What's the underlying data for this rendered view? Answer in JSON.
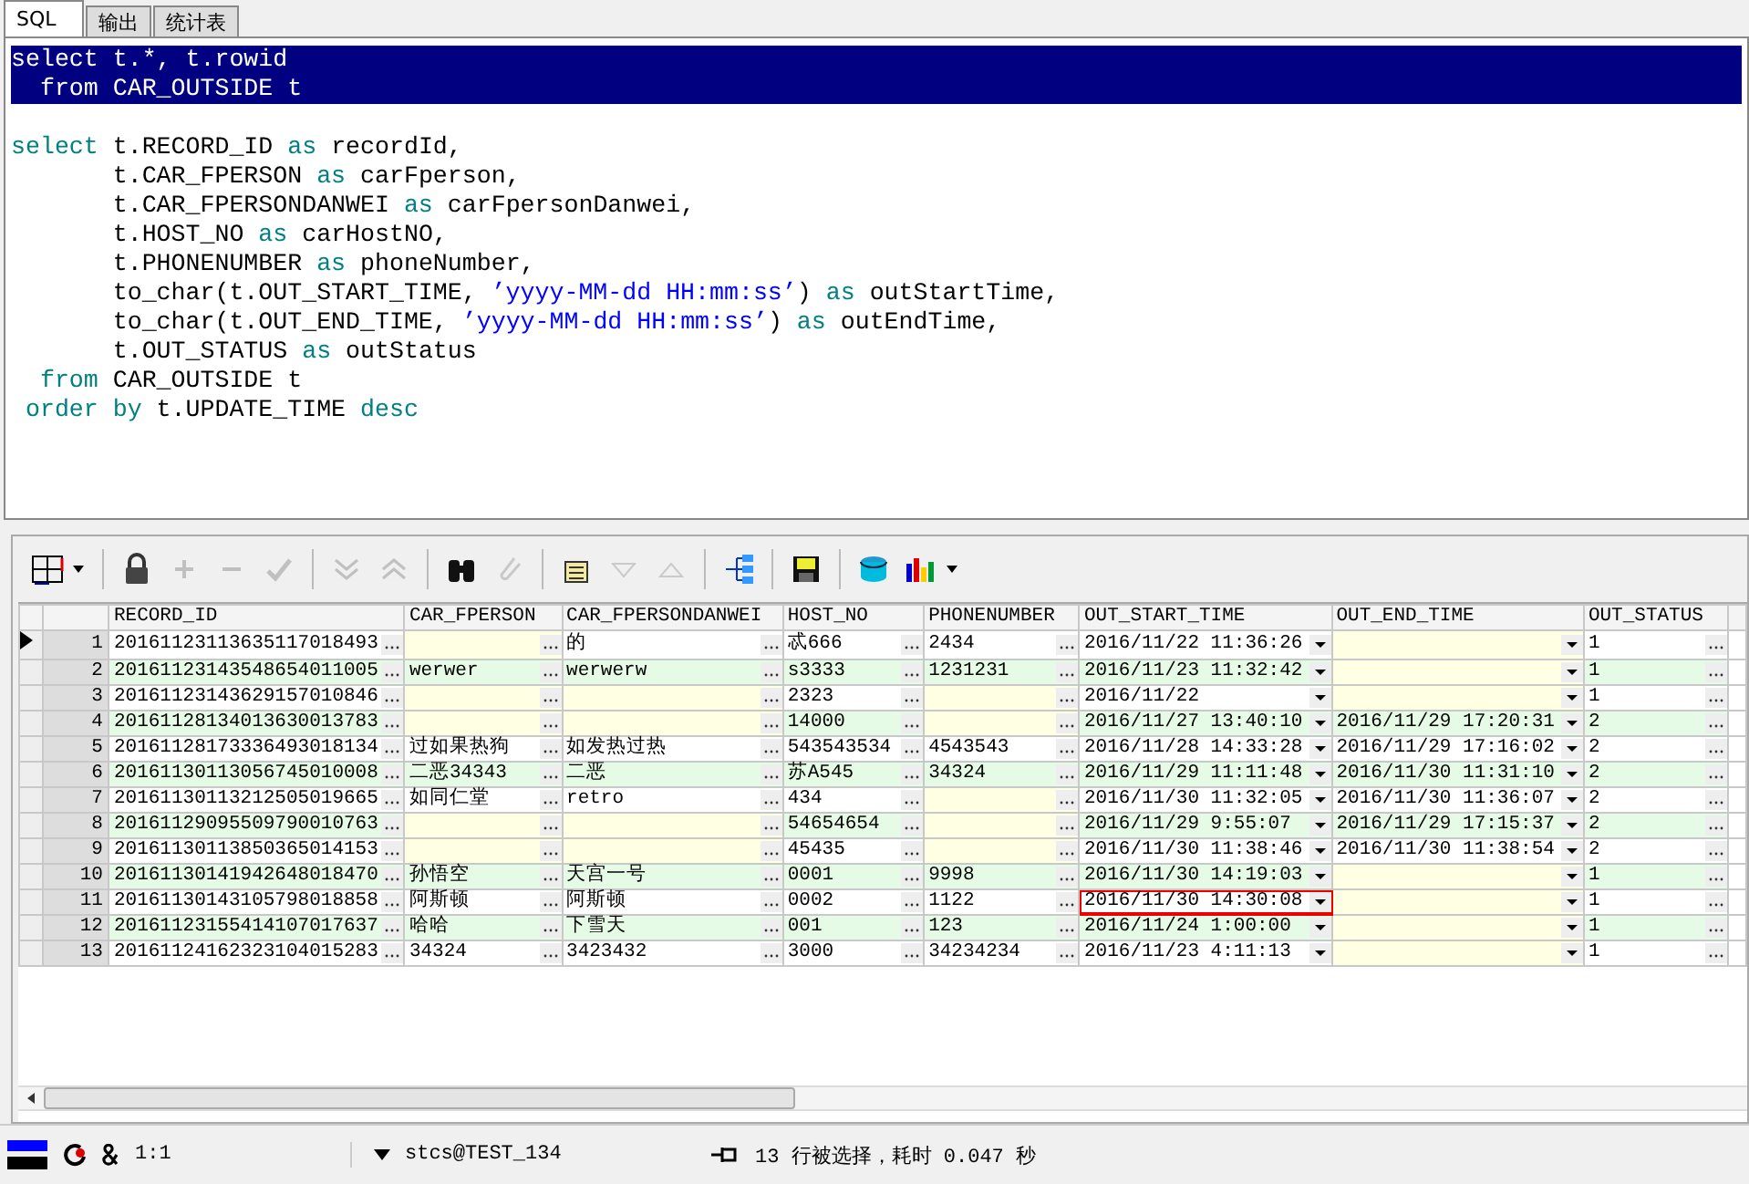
{
  "tabs": [
    {
      "label": "SQL",
      "selected": true
    },
    {
      "label": "输出",
      "selected": false
    },
    {
      "label": "统计表",
      "selected": false
    }
  ],
  "editor": {
    "lines": [
      {
        "kind": "code",
        "selected": true,
        "tokens": [
          {
            "kind": "plain",
            "text": "select t.*, t.rowid"
          }
        ]
      },
      {
        "kind": "code",
        "selected": true,
        "tokens": [
          {
            "kind": "plain",
            "text": "  from CAR_OUTSIDE t"
          }
        ]
      },
      {
        "kind": "blank"
      },
      {
        "kind": "code",
        "selected": false,
        "tokens": [
          {
            "kind": "keyword",
            "text": "select"
          },
          {
            "kind": "plain",
            "text": " t.RECORD_ID "
          },
          {
            "kind": "keyword",
            "text": "as"
          },
          {
            "kind": "plain",
            "text": " recordId,"
          }
        ]
      },
      {
        "kind": "code",
        "selected": false,
        "tokens": [
          {
            "kind": "plain",
            "text": "       t.CAR_FPERSON "
          },
          {
            "kind": "keyword",
            "text": "as"
          },
          {
            "kind": "plain",
            "text": " carFperson,"
          }
        ]
      },
      {
        "kind": "code",
        "selected": false,
        "tokens": [
          {
            "kind": "plain",
            "text": "       t.CAR_FPERSONDANWEI "
          },
          {
            "kind": "keyword",
            "text": "as"
          },
          {
            "kind": "plain",
            "text": " carFpersonDanwei,"
          }
        ]
      },
      {
        "kind": "code",
        "selected": false,
        "tokens": [
          {
            "kind": "plain",
            "text": "       t.HOST_NO "
          },
          {
            "kind": "keyword",
            "text": "as"
          },
          {
            "kind": "plain",
            "text": " carHostNO,"
          }
        ]
      },
      {
        "kind": "code",
        "selected": false,
        "tokens": [
          {
            "kind": "plain",
            "text": "       t.PHONENUMBER "
          },
          {
            "kind": "keyword",
            "text": "as"
          },
          {
            "kind": "plain",
            "text": " phoneNumber,"
          }
        ]
      },
      {
        "kind": "code",
        "selected": false,
        "tokens": [
          {
            "kind": "plain",
            "text": "       to_char(t.OUT_START_TIME, "
          },
          {
            "kind": "string",
            "text": "’yyyy-MM-dd HH:mm:ss’"
          },
          {
            "kind": "plain",
            "text": ") "
          },
          {
            "kind": "keyword",
            "text": "as"
          },
          {
            "kind": "plain",
            "text": " outStartTime,"
          }
        ]
      },
      {
        "kind": "code",
        "selected": false,
        "tokens": [
          {
            "kind": "plain",
            "text": "       to_char(t.OUT_END_TIME, "
          },
          {
            "kind": "string",
            "text": "’yyyy-MM-dd HH:mm:ss’"
          },
          {
            "kind": "plain",
            "text": ") "
          },
          {
            "kind": "keyword",
            "text": "as"
          },
          {
            "kind": "plain",
            "text": " outEndTime,"
          }
        ]
      },
      {
        "kind": "code",
        "selected": false,
        "tokens": [
          {
            "kind": "plain",
            "text": "       t.OUT_STATUS "
          },
          {
            "kind": "keyword",
            "text": "as"
          },
          {
            "kind": "plain",
            "text": " outStatus"
          }
        ]
      },
      {
        "kind": "code",
        "selected": false,
        "tokens": [
          {
            "kind": "keyword",
            "text": "  from"
          },
          {
            "kind": "plain",
            "text": " CAR_OUTSIDE t"
          }
        ]
      },
      {
        "kind": "code",
        "selected": false,
        "tokens": [
          {
            "kind": "keyword",
            "text": " order by"
          },
          {
            "kind": "plain",
            "text": " t.UPDATE_TIME "
          },
          {
            "kind": "keyword",
            "text": "desc"
          }
        ]
      }
    ]
  },
  "toolbar": [
    {
      "kind": "grid",
      "disabled": false
    },
    {
      "kind": "lock",
      "disabled": false
    },
    {
      "kind": "plus",
      "disabled": true
    },
    {
      "kind": "minus",
      "disabled": true
    },
    {
      "kind": "check",
      "disabled": true
    },
    {
      "kind": "chevrons-down",
      "disabled": true
    },
    {
      "kind": "chevrons-up",
      "disabled": true
    },
    {
      "kind": "binoculars",
      "disabled": false
    },
    {
      "kind": "clip",
      "disabled": true
    },
    {
      "kind": "export",
      "disabled": false
    },
    {
      "kind": "triangle-down",
      "disabled": true
    },
    {
      "kind": "triangle-up",
      "disabled": true
    },
    {
      "kind": "tree",
      "disabled": false
    },
    {
      "kind": "save",
      "disabled": false
    },
    {
      "kind": "database",
      "disabled": false
    },
    {
      "kind": "chart",
      "disabled": false
    }
  ],
  "table": {
    "columns": [
      {
        "label": "RECORD_ID",
        "kind": "text"
      },
      {
        "label": "CAR_FPERSON",
        "kind": "text"
      },
      {
        "label": "CAR_FPERSONDANWEI",
        "kind": "text"
      },
      {
        "label": "HOST_NO",
        "kind": "text"
      },
      {
        "label": "PHONENUMBER",
        "kind": "text"
      },
      {
        "label": "OUT_START_TIME",
        "kind": "date"
      },
      {
        "label": "OUT_END_TIME",
        "kind": "date"
      },
      {
        "label": "OUT_STATUS",
        "kind": "text"
      }
    ],
    "rows": [
      {
        "number": "1",
        "selected": true,
        "cells": [
          {
            "text": "20161123113635117018493",
            "focused": false
          },
          {
            "focused": false
          },
          {
            "text": "的",
            "focused": false
          },
          {
            "text": "忒666",
            "focused": false
          },
          {
            "text": "2434",
            "focused": false
          },
          {
            "text": "2016/11/22 11:36:26",
            "focused": false
          },
          {
            "focused": false
          },
          {
            "text": "1",
            "focused": false
          }
        ]
      },
      {
        "number": "2",
        "selected": false,
        "cells": [
          {
            "text": "20161123143548654011005",
            "focused": false
          },
          {
            "text": "werwer",
            "focused": false
          },
          {
            "text": "werwerw",
            "focused": false
          },
          {
            "text": "s3333",
            "focused": false
          },
          {
            "text": "1231231",
            "focused": false
          },
          {
            "text": "2016/11/23 11:32:42",
            "focused": false
          },
          {
            "focused": false
          },
          {
            "text": "1",
            "focused": false
          }
        ]
      },
      {
        "number": "3",
        "selected": false,
        "cells": [
          {
            "text": "20161123143629157010846",
            "focused": false
          },
          {
            "focused": false
          },
          {
            "focused": false
          },
          {
            "text": "2323",
            "focused": false
          },
          {
            "focused": false
          },
          {
            "text": "2016/11/22",
            "focused": false
          },
          {
            "focused": false
          },
          {
            "text": "1",
            "focused": false
          }
        ]
      },
      {
        "number": "4",
        "selected": false,
        "cells": [
          {
            "text": "20161128134013630013783",
            "focused": false
          },
          {
            "focused": false
          },
          {
            "focused": false
          },
          {
            "text": "14000",
            "focused": false
          },
          {
            "focused": false
          },
          {
            "text": "2016/11/27 13:40:10",
            "focused": false
          },
          {
            "text": "2016/11/29 17:20:31",
            "focused": false
          },
          {
            "text": "2",
            "focused": false
          }
        ]
      },
      {
        "number": "5",
        "selected": false,
        "cells": [
          {
            "text": "20161128173336493018134",
            "focused": false
          },
          {
            "text": "过如果热狗",
            "focused": false
          },
          {
            "text": "如发热过热",
            "focused": false
          },
          {
            "text": "543543534",
            "focused": false
          },
          {
            "text": "4543543",
            "focused": false
          },
          {
            "text": "2016/11/28 14:33:28",
            "focused": false
          },
          {
            "text": "2016/11/29 17:16:02",
            "focused": false
          },
          {
            "text": "2",
            "focused": false
          }
        ]
      },
      {
        "number": "6",
        "selected": false,
        "cells": [
          {
            "text": "20161130113056745010008",
            "focused": false
          },
          {
            "text": "二恶34343",
            "focused": false
          },
          {
            "text": "二恶",
            "focused": false
          },
          {
            "text": "苏A545",
            "focused": false
          },
          {
            "text": "34324",
            "focused": false
          },
          {
            "text": "2016/11/29 11:11:48",
            "focused": false
          },
          {
            "text": "2016/11/30 11:31:10",
            "focused": false
          },
          {
            "text": "2",
            "focused": false
          }
        ]
      },
      {
        "number": "7",
        "selected": false,
        "cells": [
          {
            "text": "20161130113212505019665",
            "focused": false
          },
          {
            "text": "如同仁堂",
            "focused": false
          },
          {
            "text": "retro",
            "focused": false
          },
          {
            "text": "434",
            "focused": false
          },
          {
            "focused": false
          },
          {
            "text": "2016/11/30 11:32:05",
            "focused": false
          },
          {
            "text": "2016/11/30 11:36:07",
            "focused": false
          },
          {
            "text": "2",
            "focused": false
          }
        ]
      },
      {
        "number": "8",
        "selected": false,
        "cells": [
          {
            "text": "20161129095509790010763",
            "focused": false
          },
          {
            "focused": false
          },
          {
            "focused": false
          },
          {
            "text": "54654654",
            "focused": false
          },
          {
            "focused": false
          },
          {
            "text": "2016/11/29 9:55:07",
            "focused": false
          },
          {
            "text": "2016/11/29 17:15:37",
            "focused": false
          },
          {
            "text": "2",
            "focused": false
          }
        ]
      },
      {
        "number": "9",
        "selected": false,
        "cells": [
          {
            "text": "20161130113850365014153",
            "focused": false
          },
          {
            "focused": false
          },
          {
            "focused": false
          },
          {
            "text": "45435",
            "focused": false
          },
          {
            "focused": false
          },
          {
            "text": "2016/11/30 11:38:46",
            "focused": false
          },
          {
            "text": "2016/11/30 11:38:54",
            "focused": false
          },
          {
            "text": "2",
            "focused": false
          }
        ]
      },
      {
        "number": "10",
        "selected": false,
        "cells": [
          {
            "text": "20161130141942648018470",
            "focused": false
          },
          {
            "text": "孙悟空",
            "focused": false
          },
          {
            "text": "天宫一号",
            "focused": false
          },
          {
            "text": "0001",
            "focused": false
          },
          {
            "text": "9998",
            "focused": false
          },
          {
            "text": "2016/11/30 14:19:03",
            "focused": false
          },
          {
            "focused": false
          },
          {
            "text": "1",
            "focused": false
          }
        ]
      },
      {
        "number": "11",
        "selected": false,
        "cells": [
          {
            "text": "20161130143105798018858",
            "focused": false
          },
          {
            "text": "阿斯顿",
            "focused": false
          },
          {
            "text": "阿斯顿",
            "focused": false
          },
          {
            "text": "0002",
            "focused": false
          },
          {
            "text": "1122",
            "focused": false
          },
          {
            "text": "2016/11/30 14:30:08",
            "focused": true
          },
          {
            "focused": false
          },
          {
            "text": "1",
            "focused": false
          }
        ]
      },
      {
        "number": "12",
        "selected": false,
        "cells": [
          {
            "text": "20161123155414107017637",
            "focused": false
          },
          {
            "text": "哈哈",
            "focused": false
          },
          {
            "text": "下雪天",
            "focused": false
          },
          {
            "text": "001",
            "focused": false
          },
          {
            "text": "123",
            "focused": false
          },
          {
            "text": "2016/11/24 1:00:00",
            "focused": false
          },
          {
            "focused": false
          },
          {
            "text": "1",
            "focused": false
          }
        ]
      },
      {
        "number": "13",
        "selected": false,
        "cells": [
          {
            "text": "20161124162323104015283",
            "focused": false
          },
          {
            "text": "34324",
            "focused": false
          },
          {
            "text": "3423432",
            "focused": false
          },
          {
            "text": "3000",
            "focused": false
          },
          {
            "text": "34234234",
            "focused": false
          },
          {
            "text": "2016/11/23 4:11:13",
            "focused": false
          },
          {
            "focused": false
          },
          {
            "text": "1",
            "focused": false
          }
        ]
      }
    ]
  },
  "status_bar": {
    "position": "1:1",
    "connection": "stcs@TEST_134",
    "message": "13 行被选择，耗时 0.047 秒"
  }
}
